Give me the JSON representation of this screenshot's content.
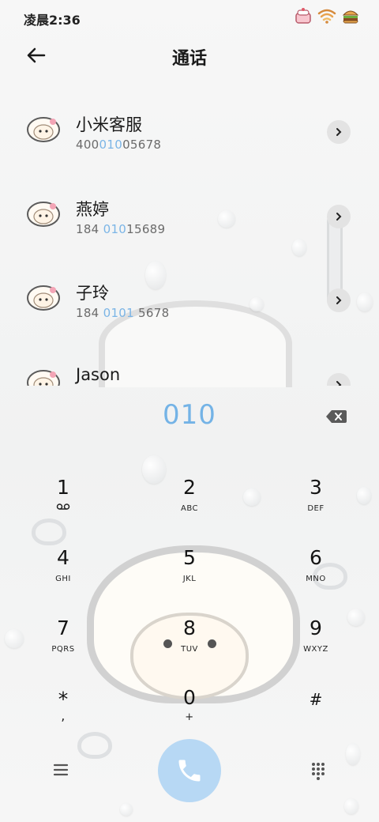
{
  "status_bar": {
    "time": "凌晨2:36",
    "icons": [
      "cake-battery-icon",
      "wifi-icon",
      "burger-sticker-icon"
    ]
  },
  "header": {
    "title": "通话",
    "back_icon": "back-arrow-icon"
  },
  "contacts": [
    {
      "name": "小米客服",
      "number_pre": "400",
      "number_hl": "010",
      "number_post": "05678"
    },
    {
      "name": "燕婷",
      "number_pre": "184 ",
      "number_hl": "010",
      "number_post": "15689"
    },
    {
      "name": "子玲",
      "number_pre": "184 ",
      "number_hl": "0101",
      "number_post": " 5678"
    },
    {
      "name": "Jason",
      "number_pre": "",
      "number_hl": "",
      "number_post": ""
    }
  ],
  "dial": {
    "number": "010",
    "backspace_icon": "backspace-icon"
  },
  "keypad": [
    {
      "digit": "1",
      "letters": "",
      "icon": "voicemail-icon"
    },
    {
      "digit": "2",
      "letters": "ABC"
    },
    {
      "digit": "3",
      "letters": "DEF"
    },
    {
      "digit": "4",
      "letters": "GHI"
    },
    {
      "digit": "5",
      "letters": "JKL"
    },
    {
      "digit": "6",
      "letters": "MNO"
    },
    {
      "digit": "7",
      "letters": "PQRS"
    },
    {
      "digit": "8",
      "letters": "TUV"
    },
    {
      "digit": "9",
      "letters": "WXYZ"
    },
    {
      "digit": "*",
      "letters": ","
    },
    {
      "digit": "0",
      "letters": "+"
    },
    {
      "digit": "#",
      "letters": ""
    }
  ],
  "bottom_bar": {
    "menu_icon": "menu-icon",
    "call_icon": "phone-icon",
    "keypad_icon": "dialpad-grid-icon"
  },
  "colors": {
    "accent": "#74b3e6",
    "call_button": "#b7d8f4",
    "text": "#1a1a1a"
  }
}
